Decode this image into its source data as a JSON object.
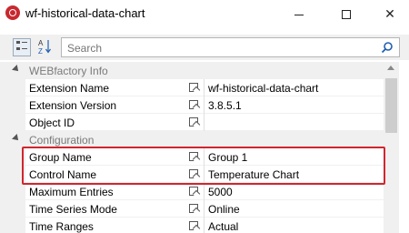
{
  "window": {
    "title": "wf-historical-data-chart"
  },
  "toolbar": {
    "search_placeholder": "Search"
  },
  "categories": [
    {
      "label": "WEBfactory Info"
    },
    {
      "label": "Configuration"
    }
  ],
  "properties": [
    {
      "name": "Extension Name",
      "value": "wf-historical-data-chart"
    },
    {
      "name": "Extension Version",
      "value": "3.8.5.1"
    },
    {
      "name": "Object ID",
      "value": ""
    },
    {
      "name": "Group Name",
      "value": "Group 1"
    },
    {
      "name": "Control Name",
      "value": "Temperature Chart"
    },
    {
      "name": "Maximum Entries",
      "value": "5000"
    },
    {
      "name": "Time Series Mode",
      "value": "Online"
    },
    {
      "name": "Time Ranges",
      "value": "Actual"
    }
  ],
  "colors": {
    "highlight": "#d0262e",
    "category_text": "#7a7a7a"
  }
}
